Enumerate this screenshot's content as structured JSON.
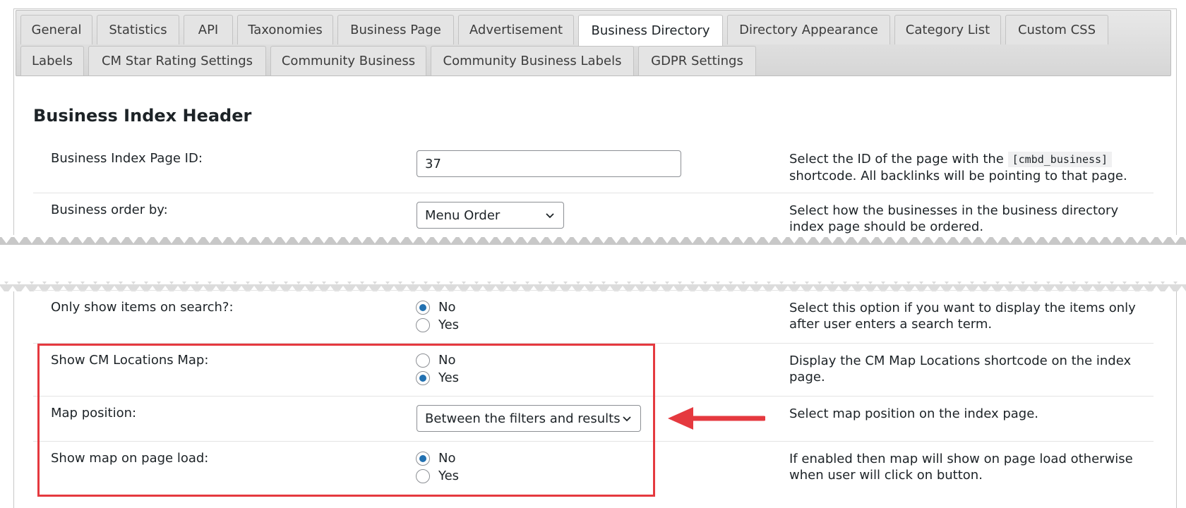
{
  "tabs": [
    {
      "label": "General"
    },
    {
      "label": "Statistics"
    },
    {
      "label": "API"
    },
    {
      "label": "Taxonomies"
    },
    {
      "label": "Business Page"
    },
    {
      "label": "Advertisement"
    },
    {
      "label": "Business Directory",
      "active": true
    },
    {
      "label": "Directory Appearance"
    },
    {
      "label": "Category List"
    },
    {
      "label": "Custom CSS"
    },
    {
      "label": "Labels"
    },
    {
      "label": "CM Star Rating Settings"
    },
    {
      "label": "Community Business"
    },
    {
      "label": "Community Business Labels"
    },
    {
      "label": "GDPR Settings"
    }
  ],
  "section": {
    "title": "Business Index Header"
  },
  "settings": {
    "page_id": {
      "label": "Business Index Page ID:",
      "value": "37",
      "desc_before": "Select the ID of the page with the",
      "desc_code": "[cmbd_business]",
      "desc_after": "shortcode. All backlinks will be pointing to that page."
    },
    "order_by": {
      "label": "Business order by:",
      "selected": "Menu Order",
      "desc": "Select how the businesses in the business directory index page should be ordered."
    },
    "search_only": {
      "label": "Only show items on search?:",
      "option_no": "No",
      "option_yes": "Yes",
      "selected": "No",
      "desc": "Select this option if you want to display the items only after user enters a search term."
    },
    "show_map": {
      "label": "Show CM Locations Map:",
      "option_no": "No",
      "option_yes": "Yes",
      "selected": "Yes",
      "desc": "Display the CM Map Locations shortcode on the index page."
    },
    "map_position": {
      "label": "Map position:",
      "selected": "Between the filters and results",
      "desc": "Select map position on the index page."
    },
    "map_on_load": {
      "label": "Show map on page load:",
      "option_no": "No",
      "option_yes": "Yes",
      "selected": "No",
      "desc": "If enabled then map will show on page load otherwise when user will click on button."
    }
  },
  "colors": {
    "highlight": "#e5393f",
    "radio_accent": "#2271b1"
  },
  "icons": {
    "select_chevron": "chevron-down-icon",
    "callout": "arrow-left-icon"
  }
}
